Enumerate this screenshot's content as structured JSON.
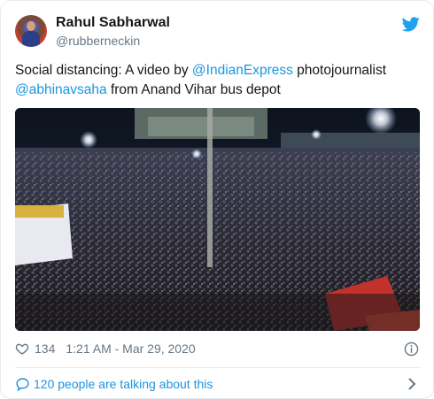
{
  "author": {
    "name": "Rahul Sabharwal",
    "handle": "@rubberneckin"
  },
  "tweet": {
    "text_1": "Social distancing: A video by ",
    "mention_1": "@IndianExpress",
    "text_2": " photojournalist ",
    "mention_2": "@abhinavsaha",
    "text_3": " from Anand Vihar bus depot"
  },
  "icons": {
    "brand": "twitter-bird-icon",
    "like": "heart-icon",
    "info": "info-icon",
    "reply": "speech-bubble-icon",
    "more": "chevron-right-icon"
  },
  "stats": {
    "likes": "134",
    "timestamp": "1:21 AM - Mar 29, 2020"
  },
  "conversation": {
    "label": "120 people are talking about this"
  },
  "colors": {
    "accent": "#1b95e0",
    "brand_bird": "#1da1f2",
    "secondary_text": "#657786"
  }
}
